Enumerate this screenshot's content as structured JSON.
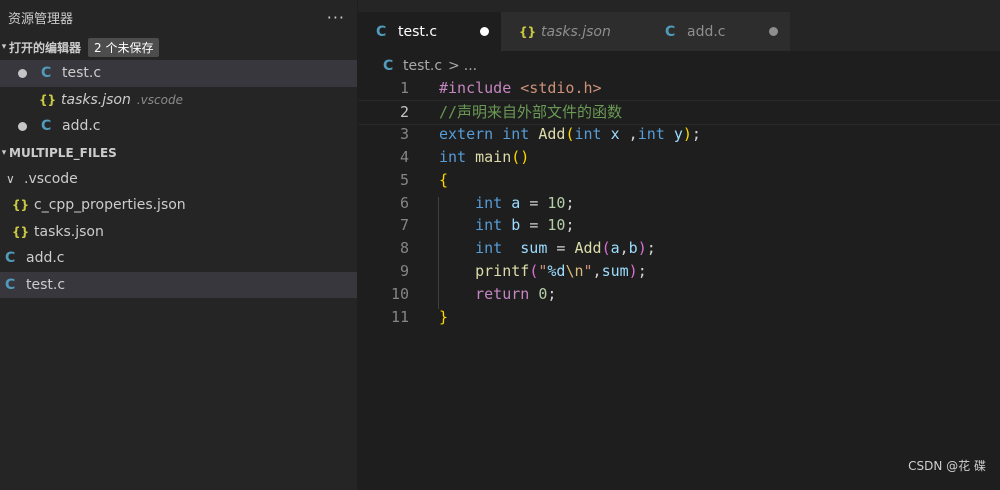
{
  "sidebar": {
    "title": "资源管理器",
    "more": "···",
    "open_editors": {
      "label": "打开的编辑器",
      "badge": "2 个未保存",
      "items": [
        {
          "name": "test.c",
          "icon": "C",
          "unsaved": true,
          "active": true
        },
        {
          "name": "tasks.json",
          "icon": "{}",
          "desc": ".vscode",
          "italic": true
        },
        {
          "name": "add.c",
          "icon": "C",
          "unsaved": true
        }
      ]
    },
    "workspace": {
      "label": "MULTIPLE_FILES",
      "folder": ".vscode",
      "folder_items": [
        {
          "name": "c_cpp_properties.json",
          "icon": "{}"
        },
        {
          "name": "tasks.json",
          "icon": "{}"
        }
      ],
      "files": [
        {
          "name": "add.c",
          "icon": "C"
        },
        {
          "name": "test.c",
          "icon": "C",
          "active": true
        }
      ]
    }
  },
  "tabs": [
    {
      "label": "test.c",
      "icon": "C",
      "active": true,
      "unsaved": true
    },
    {
      "label": "tasks.json",
      "icon": "{}",
      "italic": true
    },
    {
      "label": "add.c",
      "icon": "C",
      "unsaved": true
    }
  ],
  "breadcrumb": {
    "icon": "C",
    "file": "test.c",
    "sep": ">",
    "more": "..."
  },
  "editor": {
    "current_line": 2,
    "line_numbers": [
      "1",
      "2",
      "3",
      "4",
      "5",
      "6",
      "7",
      "8",
      "9",
      "10",
      "11"
    ],
    "lines": [
      [
        [
          "pp",
          "#include "
        ],
        [
          "incl",
          "<stdio.h>"
        ]
      ],
      [
        [
          "cm",
          "//声明来自外部文件的函数"
        ]
      ],
      [
        [
          "kw",
          "extern "
        ],
        [
          "kw",
          "int "
        ],
        [
          "fn",
          "Add"
        ],
        [
          "p1",
          "("
        ],
        [
          "kw",
          "int "
        ],
        [
          "var",
          "x "
        ],
        [
          "plain",
          ","
        ],
        [
          "kw",
          "int "
        ],
        [
          "var",
          "y"
        ],
        [
          "p1",
          ")"
        ],
        [
          "plain",
          ";"
        ]
      ],
      [
        [
          "kw",
          "int "
        ],
        [
          "fn",
          "main"
        ],
        [
          "p1",
          "()"
        ]
      ],
      [
        [
          "p1",
          "{"
        ]
      ],
      [
        [
          "plain",
          "    "
        ],
        [
          "kw",
          "int "
        ],
        [
          "var",
          "a "
        ],
        [
          "plain",
          "= "
        ],
        [
          "num",
          "10"
        ],
        [
          "plain",
          ";"
        ]
      ],
      [
        [
          "plain",
          "    "
        ],
        [
          "kw",
          "int "
        ],
        [
          "var",
          "b "
        ],
        [
          "plain",
          "= "
        ],
        [
          "num",
          "10"
        ],
        [
          "plain",
          ";"
        ]
      ],
      [
        [
          "plain",
          "    "
        ],
        [
          "kw",
          "int  "
        ],
        [
          "var",
          "sum "
        ],
        [
          "plain",
          "= "
        ],
        [
          "fn",
          "Add"
        ],
        [
          "p2",
          "("
        ],
        [
          "var",
          "a"
        ],
        [
          "plain",
          ","
        ],
        [
          "var",
          "b"
        ],
        [
          "p2",
          ")"
        ],
        [
          "plain",
          ";"
        ]
      ],
      [
        [
          "plain",
          "    "
        ],
        [
          "fn",
          "printf"
        ],
        [
          "p2",
          "("
        ],
        [
          "str",
          "\""
        ],
        [
          "var",
          "%d"
        ],
        [
          "esc",
          "\\n"
        ],
        [
          "str",
          "\""
        ],
        [
          "plain",
          ","
        ],
        [
          "var",
          "sum"
        ],
        [
          "p2",
          ")"
        ],
        [
          "plain",
          ";"
        ]
      ],
      [
        [
          "plain",
          "    "
        ],
        [
          "ctl",
          "return "
        ],
        [
          "num",
          "0"
        ],
        [
          "plain",
          ";"
        ]
      ],
      [
        [
          "p1",
          "}"
        ]
      ]
    ]
  },
  "watermark": "CSDN @花 碟",
  "colors": {
    "accent_c": "#519aba",
    "accent_json": "#cbcb41"
  }
}
